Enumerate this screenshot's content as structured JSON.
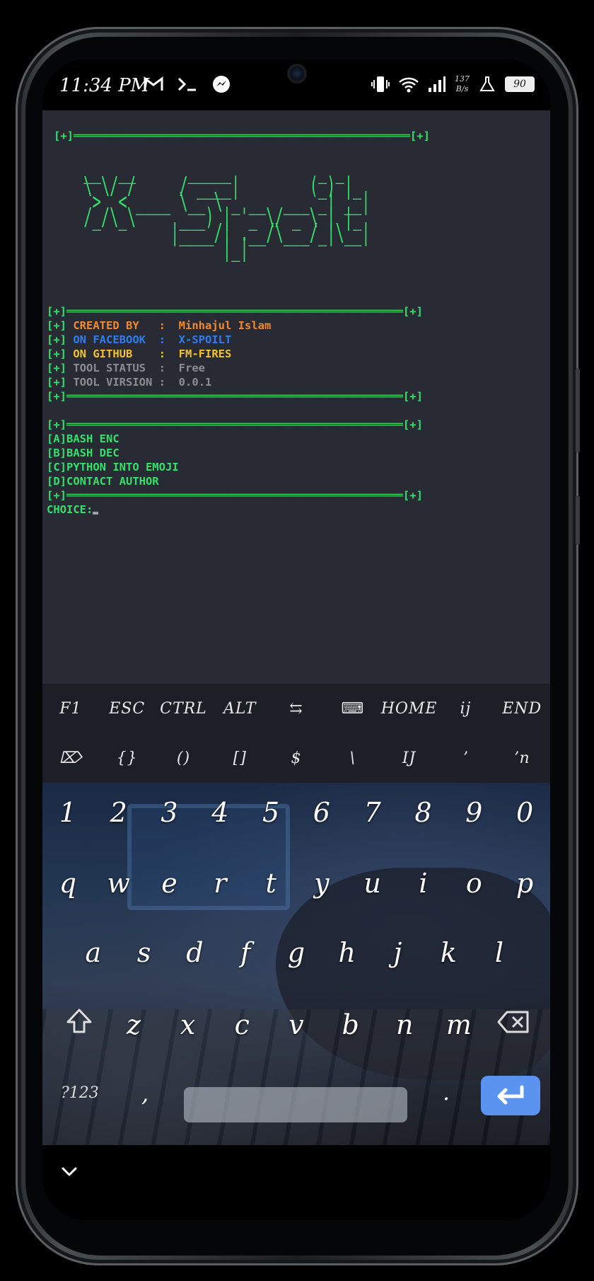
{
  "status_bar": {
    "time": "11:34 PM",
    "net_speed_value": "137",
    "net_speed_unit": "B/s",
    "battery": "90"
  },
  "terminal": {
    "top_border": "[+]═══════════════════════════════════════════════════[+]",
    "banner_lines": [
      " __  __      _____          _ _ ",
      " \\ \\/ /     / ____|        (_) |_",
      "  >  < ____ \\__ \\ _ __  ___ _| __|",
      " /_/\\_\\     ___) | '_ \\/ _ \\ | |_",
      "           |____/| .__/\\___/_|\\__|",
      "                 |_|"
    ],
    "border": "[+]═══════════════════════════════════════════════════[+]",
    "prefix": "[+]",
    "info": [
      {
        "label": "CREATED BY   :",
        "value": "Minhajul Islam"
      },
      {
        "label": "ON FACEBOOK  :",
        "value": "X-SPOILT"
      },
      {
        "label": "ON GITHUB    :",
        "value": "FM-FIRES"
      },
      {
        "label": "TOOL STATUS  :",
        "value": "Free"
      },
      {
        "label": "TOOL VIRSION :",
        "value": "0.0.1"
      }
    ],
    "menu": [
      "[A]BASH ENC",
      "[B]BASH DEC",
      "[C]PYTHON INTO EMOJI",
      "[D]CONTACT AUTHOR"
    ],
    "prompt": "CHOICE:"
  },
  "extra_keys": {
    "row1": [
      "F1",
      "ESC",
      "CTRL",
      "ALT",
      "⇆",
      "⌨",
      "HOME",
      "ij",
      "END"
    ],
    "row2": [
      "⌦",
      "{}",
      "()",
      "[]",
      "$",
      "\\",
      "IJ",
      "ʼ",
      "ʼn"
    ]
  },
  "keyboard": {
    "numbers": [
      "1",
      "2",
      "3",
      "4",
      "5",
      "6",
      "7",
      "8",
      "9",
      "0"
    ],
    "row1": [
      "q",
      "w",
      "e",
      "r",
      "t",
      "y",
      "u",
      "i",
      "o",
      "p"
    ],
    "row2": [
      "a",
      "s",
      "d",
      "f",
      "g",
      "h",
      "j",
      "k",
      "l"
    ],
    "row3": [
      "z",
      "x",
      "c",
      "v",
      "b",
      "n",
      "m"
    ],
    "symbols_key": "?123",
    "comma": ",",
    "period": "."
  }
}
